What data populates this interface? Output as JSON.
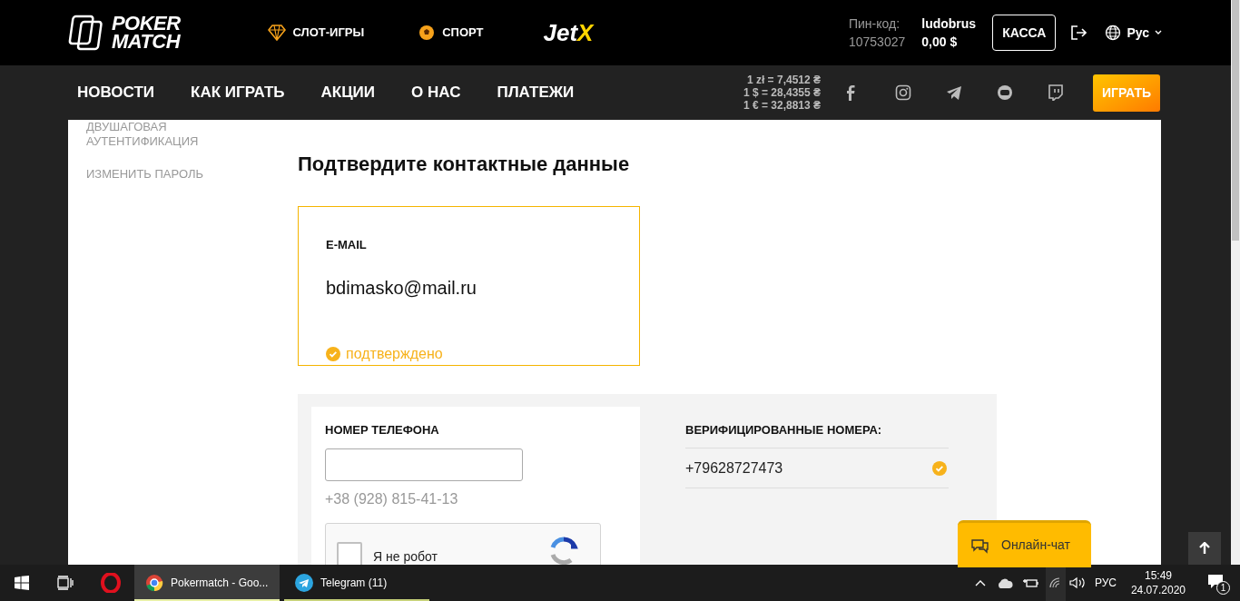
{
  "header": {
    "logo_lines": [
      "POKER",
      "MATCH"
    ],
    "top_links": [
      {
        "label": "СЛОТ-ИГРЫ",
        "kind": "slots"
      },
      {
        "label": "СПОРТ",
        "kind": "sport"
      }
    ],
    "jetx": {
      "main": "Jet",
      "accent": "X"
    },
    "pin_label": "Пин-код:",
    "pin": "10753027",
    "username": "ludobrus",
    "balance": "0,00 $",
    "cashier_button": "КАССА",
    "language": "Рус"
  },
  "nav": {
    "items": [
      "НОВОСТИ",
      "КАК ИГРАТЬ",
      "АКЦИИ",
      "О НАС",
      "ПЛАТЕЖИ"
    ],
    "rates": [
      "1 zł = 7,4512 ₴",
      "1 $ = 28,4355 ₴",
      "1 € = 32,8813 ₴"
    ],
    "social": [
      {
        "kind": "facebook"
      },
      {
        "kind": "instagram"
      },
      {
        "kind": "telegram"
      },
      {
        "kind": "youtube"
      },
      {
        "kind": "twitch"
      }
    ],
    "play_button": "ИГРАТЬ"
  },
  "sidebar": {
    "items": [
      "ДВУШАГОВАЯ АУТЕНТИФИКАЦИЯ",
      "ИЗМЕНИТЬ ПАРОЛЬ"
    ]
  },
  "page_title": "Подтвердите контактные данные",
  "email_card": {
    "label": "E-MAIL",
    "value": "bdimasko@mail.ru",
    "status": "подтверждено",
    "verified": true
  },
  "phone_form": {
    "label": "НОМЕР ТЕЛЕФОНА",
    "hint": "+38 (928) 815-41-13",
    "captcha": {
      "label": "Я не робот",
      "checked": false
    }
  },
  "verified_numbers": {
    "title": "ВЕРИФИЦИРОВАННЫЕ НОМЕРА:",
    "items": [
      {
        "number": "+79628727473",
        "verified": true
      }
    ]
  },
  "chat_button": "Онлайн-чат",
  "taskbar": {
    "apps": [
      {
        "label": "Pokermatch - Goo...",
        "kind": "chrome",
        "selected": true
      },
      {
        "label": "Telegram (11)",
        "kind": "telegram",
        "selected": false
      }
    ],
    "language": "РУС",
    "time": "15:49",
    "date": "24.07.2020",
    "notifications": "1"
  }
}
